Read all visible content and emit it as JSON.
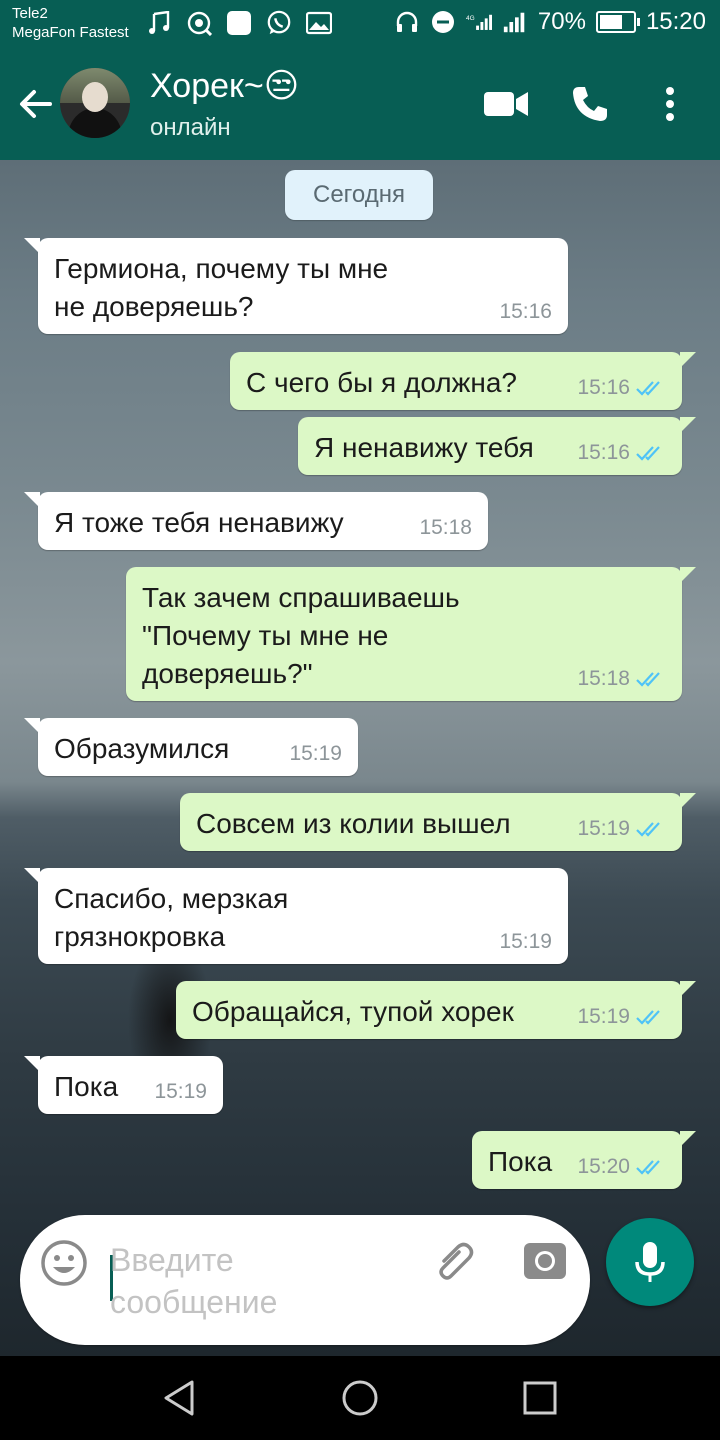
{
  "status_bar": {
    "carrier1": "Tele2",
    "carrier2": "MegaFon Fastest",
    "battery": "70%",
    "battery_level": 0.7,
    "time": "15:20",
    "left_icons": [
      "music-note-icon",
      "hotspot-icon",
      "app-square-icon",
      "whatsapp-icon",
      "gallery-icon"
    ],
    "right_icons": [
      "headset-icon",
      "do-not-disturb-icon",
      "signal-4g-icon",
      "signal-icon",
      "battery-icon"
    ]
  },
  "header": {
    "contact_name": "Хорек~😒",
    "status": "онлайн",
    "back_icon": "arrow-back-icon",
    "video_icon": "video-call-icon",
    "call_icon": "phone-icon",
    "menu_icon": "more-vert-icon"
  },
  "chat": {
    "date_label": "Сегодня",
    "messages": [
      {
        "dir": "in",
        "text": "Гермиона, почему ты мне\nне доверяешь?",
        "time": "15:16"
      },
      {
        "dir": "out",
        "text": "С чего бы я должна?",
        "time": "15:16",
        "read": true
      },
      {
        "dir": "out",
        "text": "Я ненавижу тебя",
        "time": "15:16",
        "read": true
      },
      {
        "dir": "in",
        "text": "Я тоже тебя ненавижу",
        "time": "15:18"
      },
      {
        "dir": "out",
        "text": "Так зачем спрашиваешь\n\"Почему ты мне не\nдоверяешь?\"",
        "time": "15:18",
        "read": true
      },
      {
        "dir": "in",
        "text": "Образумился",
        "time": "15:19"
      },
      {
        "dir": "out",
        "text": "Совсем из колии вышел",
        "time": "15:19",
        "read": true
      },
      {
        "dir": "in",
        "text": "Спасибо, мерзкая\nгрязнокровка",
        "time": "15:19"
      },
      {
        "dir": "out",
        "text": "Обращайся, тупой хорек",
        "time": "15:19",
        "read": true
      },
      {
        "dir": "in",
        "text": "Пока",
        "time": "15:19"
      },
      {
        "dir": "out",
        "text": "Пока",
        "time": "15:20",
        "read": true
      }
    ]
  },
  "composer": {
    "placeholder": "Введите\nсообщение",
    "emoji_icon": "emoji-icon",
    "attach_icon": "paperclip-icon",
    "camera_icon": "camera-icon",
    "mic_icon": "microphone-icon"
  },
  "nav_bar": {
    "back_icon": "nav-back-icon",
    "home_icon": "nav-home-icon",
    "recents_icon": "nav-recents-icon"
  },
  "colors": {
    "header": "#075e54",
    "outgoing_bubble": "#dcf8c6",
    "incoming_bubble": "#ffffff",
    "read_ticks": "#4fc3f7",
    "mic_button": "#00897b"
  }
}
